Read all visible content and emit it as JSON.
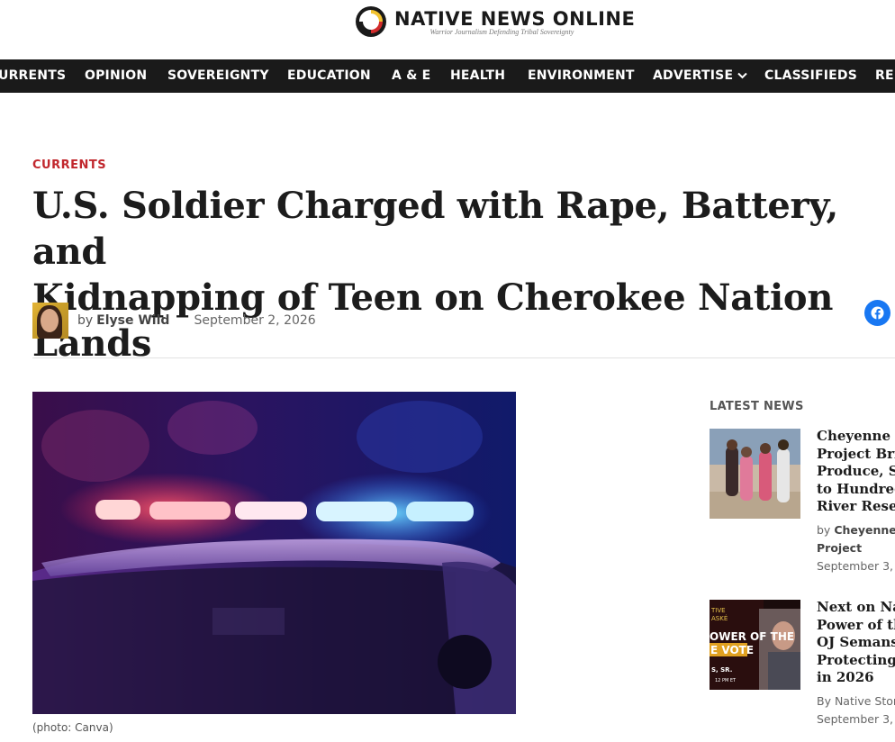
{
  "header": {
    "logo_name": "NATIVE NEWS ONLINE",
    "logo_tagline": "Warrior Journalism Defending Tribal Sovereignty"
  },
  "nav": {
    "items": [
      {
        "label": "URRENTS"
      },
      {
        "label": "OPINION"
      },
      {
        "label": "SOVEREIGNTY"
      },
      {
        "label": "EDUCATION"
      },
      {
        "label": "A & E"
      },
      {
        "label": "HEALTH"
      },
      {
        "label": "ENVIRONMENT"
      },
      {
        "label": "ADVERTISE"
      },
      {
        "label": "CLASSIFIEDS"
      },
      {
        "label": "RE"
      }
    ]
  },
  "article": {
    "kicker": "CURRENTS",
    "title_line1": "U.S. Soldier Charged with Rape, Battery, and",
    "title_line2": "Kidnapping of Teen on Cherokee Nation Lands",
    "by_prefix": "by",
    "author": "Elyse Wild",
    "date": "September 2, 2026",
    "photo_caption": "(photo: Canva)"
  },
  "sidebar": {
    "heading": "LATEST NEWS",
    "items": [
      {
        "title_lines": [
          "Cheyenne R",
          "Project Brin",
          "Produce, Sc",
          "to Hundred",
          "River Reser"
        ],
        "by_prefix": "by",
        "author_lines": [
          "Cheyenne",
          "Project"
        ],
        "date": "September 3,"
      },
      {
        "title_lines": [
          "Next on Na",
          "Power of th",
          "OJ Semans,",
          "Protecting V",
          "in 2026"
        ],
        "by_line": "By Native Stor",
        "date": "September 3,",
        "thumb_text": {
          "top1": "TIVE",
          "top2": "ASKÉ",
          "headline1": "OWER OF THE",
          "headline2": "E VOTE",
          "sub": "S, SR.",
          "time": "12 PM ET"
        }
      }
    ]
  },
  "colors": {
    "accent_red": "#c1272d",
    "nav_bg": "#1a1a1a",
    "facebook_blue": "#1877f2"
  }
}
